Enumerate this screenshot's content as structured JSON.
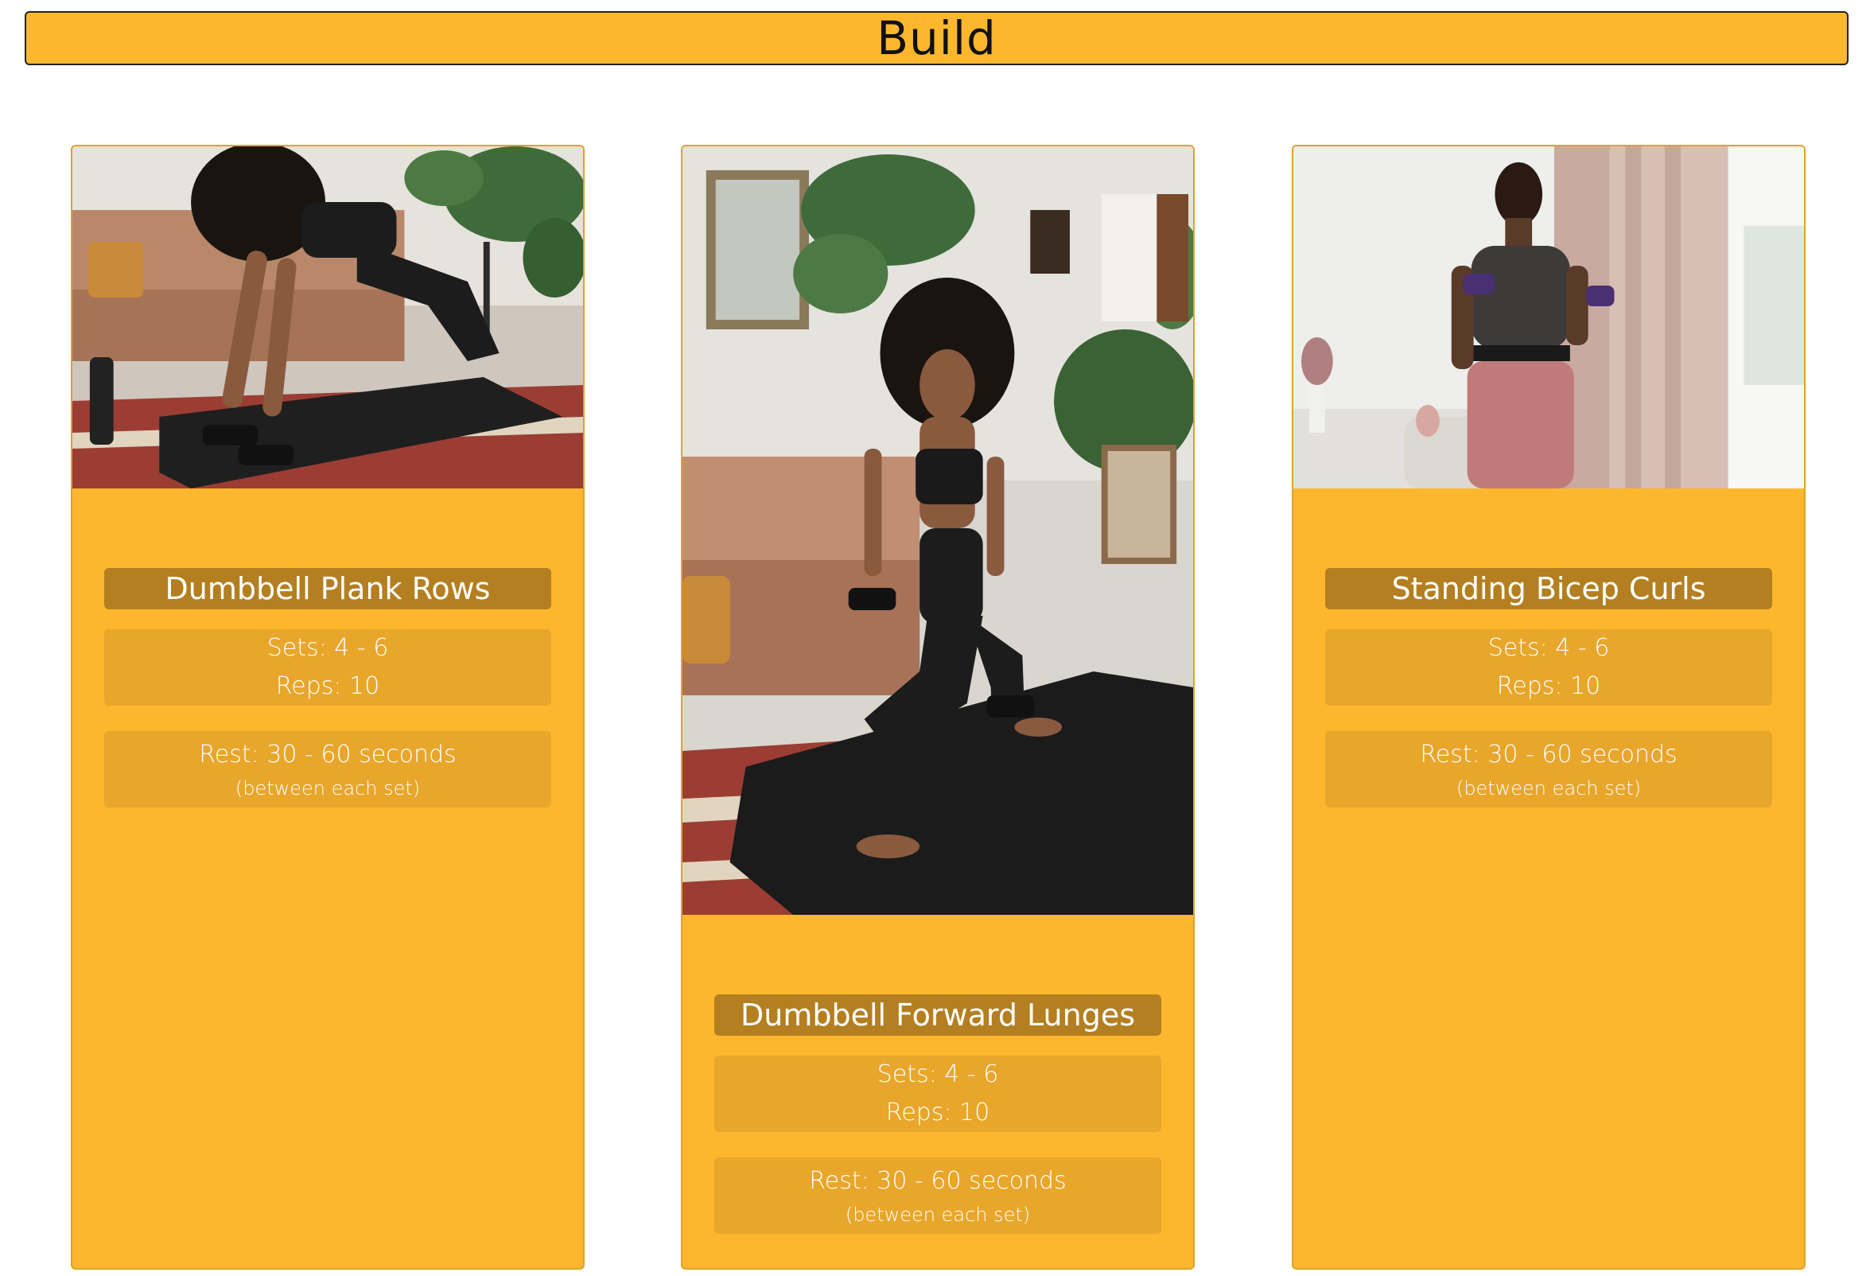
{
  "header": {
    "title": "Build"
  },
  "colors": {
    "accent": "#fcb72e",
    "title_bar": "#b37f21",
    "info_box": "#e8a62b"
  },
  "exercises": [
    {
      "name": "Dumbbell Plank Rows",
      "sets": "Sets: 4 - 6",
      "reps": "Reps: 10",
      "rest": "Rest: 30 - 60 seconds",
      "rest_note": "(between each set)"
    },
    {
      "name": "Dumbbell Forward Lunges",
      "sets": "Sets: 4 - 6",
      "reps": "Reps: 10",
      "rest": "Rest: 30 - 60 seconds",
      "rest_note": "(between each set)"
    },
    {
      "name": "Standing Bicep Curls",
      "sets": "Sets: 4 - 6",
      "reps": "Reps: 10",
      "rest": "Rest: 30 - 60 seconds",
      "rest_note": "(between each set)"
    }
  ]
}
